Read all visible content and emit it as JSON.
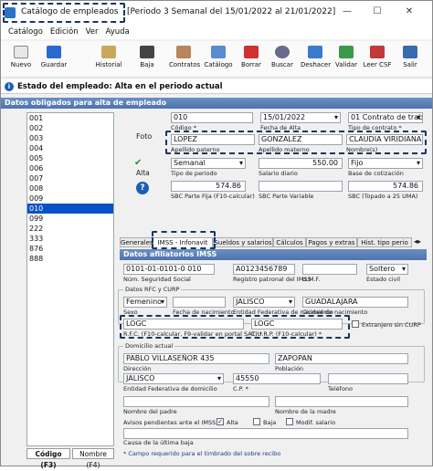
{
  "title": {
    "app": "Catálogo de empleados",
    "period": "[Periodo 3 Semanal del 15/01/2022 al 21/01/2022]",
    "min": "—",
    "max": "☐",
    "close": "✕"
  },
  "menu": [
    "Catálogo",
    "Edición",
    "Ver",
    "Ayuda"
  ],
  "toolbar": [
    "Nuevo",
    "Guardar",
    "Historial",
    "Baja",
    "Contratos",
    "Catálogo",
    "Borrar",
    "Buscar",
    "Deshacer",
    "Validar",
    "Leer CSF",
    "Salir"
  ],
  "estado": "Estado del empleado: Alta en el periodo actual",
  "section_obligatorios": "Datos obligados para alta de empleado",
  "list": [
    "001",
    "002",
    "003",
    "004",
    "005",
    "006",
    "007",
    "008",
    "009",
    "010",
    "099",
    "222",
    "333",
    "876",
    "888"
  ],
  "selected_index": 9,
  "foto_label": "Foto",
  "alta_label": "Alta",
  "codigo": {
    "value": "010",
    "label": "Código *"
  },
  "fecha_alta": {
    "value": "15/01/2022",
    "label": "Fecha de Alta"
  },
  "tipo_contrato": {
    "value": "01 Contrato de trab",
    "label": "Tipo de contrato *"
  },
  "apellido_paterno": {
    "value": "LOPEZ",
    "label": "Apellido paterno"
  },
  "apellido_materno": {
    "value": "GONZALEZ",
    "label": "Apellido materno"
  },
  "nombres": {
    "value": "CLAUDIA VIRIDIANA",
    "label": "Nombre(s)"
  },
  "tipo_periodo": {
    "value": "Semanal",
    "label": "Tipo de periodo"
  },
  "salario_diario": {
    "value": "550.00",
    "label": "Salario diario"
  },
  "base_cotizacion": {
    "value": "Fijo",
    "label": "Base de cotización"
  },
  "sbc_fija": {
    "value": "574.86",
    "label": "SBC Parte Fija (F10-calcular)"
  },
  "sbc_variable": {
    "value": "",
    "label": "SBC Parte Variable"
  },
  "sbc_tope": {
    "value": "574.86",
    "label": "SBC (Topado a 25 UMA)"
  },
  "tabs": [
    "Generales",
    "IMSS - Infonavit",
    "Sueldos y salarios",
    "Cálculos",
    "Pagos y extras",
    "Hist. tipo perio"
  ],
  "section_imss": "Datos afiliatorios IMSS",
  "nss": {
    "value": "0101-01-0101-0 010",
    "label": "Núm. Seguridad Social"
  },
  "registro_patronal": {
    "value": "A0123456789",
    "label": "Registro patronal del IMSS"
  },
  "umf": {
    "value": "",
    "label": "U.M.F."
  },
  "estado_civil": {
    "value": "Soltero",
    "label": "Estado civil"
  },
  "rfc_curp_group": "Datos RFC y CURP",
  "sexo": {
    "value": "Femenino",
    "label": "Sexo"
  },
  "fecha_nacimiento": {
    "value": "",
    "label": "Fecha de nacimiento"
  },
  "entidad_nacimiento": {
    "value": "JALISCO",
    "label": "Entidad Federativa de nacimiento"
  },
  "ciudad_nacimiento": {
    "value": "GUADALAJARA",
    "label": "Ciudad de nacimiento"
  },
  "rfc": {
    "value": "LOGC",
    "label": "R.F.C. (F10-calcular, F9-validar en portal SAT) *"
  },
  "curp": {
    "value": "LOGC",
    "label": "C.U.R.P. (F10-calcular) *"
  },
  "extranjero": "Extranjero sin CURP",
  "domicilio_group": "Domicilio actual",
  "direccion": {
    "value": "PABLO VILLASEÑOR 435",
    "label": "Dirección"
  },
  "poblacion": {
    "value": "ZAPOPAN",
    "label": "Población"
  },
  "entidad_domicilio": {
    "value": "JALISCO",
    "label": "Entidad Federativa de domicilio"
  },
  "cp": {
    "value": "45550",
    "label": "C.P. *"
  },
  "telefono": {
    "value": "",
    "label": "Teléfono"
  },
  "nombre_padre": "Nombre del padre",
  "nombre_madre": "Nombre de la madre",
  "avisos": "Avisos pendientes ante el IMSS:",
  "avisos_opts": [
    "Alta",
    "Baja",
    "Modif. salario"
  ],
  "causa_baja": "Causa de la última baja",
  "footnote": "* Campo requerido para el timbrado del sobre recibo",
  "bottom_tabs": [
    "Código (F3)",
    "Nombre (F4)"
  ]
}
